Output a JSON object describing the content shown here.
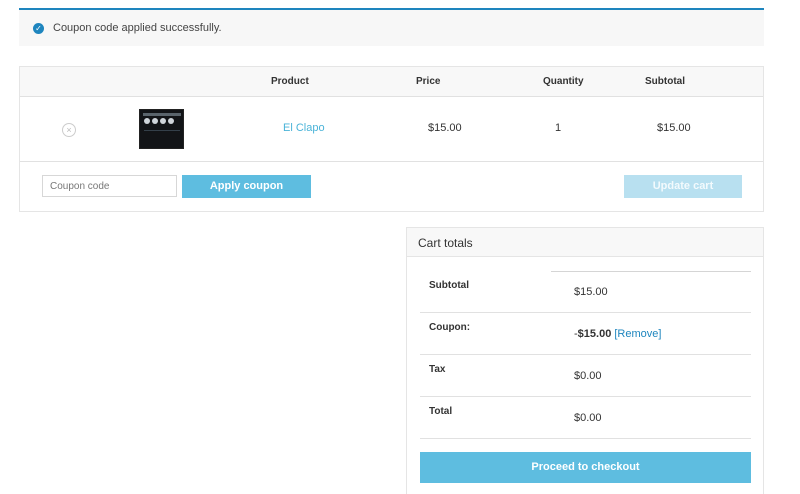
{
  "notice": {
    "message": "Coupon code applied successfully.",
    "icon": "check-circle-icon",
    "accent": "#1e85be"
  },
  "cart": {
    "headers": {
      "product": "Product",
      "price": "Price",
      "quantity": "Quantity",
      "subtotal": "Subtotal"
    },
    "items": [
      {
        "name": "El Clapo",
        "price": "$15.00",
        "quantity": "1",
        "subtotal": "$15.00",
        "remove_icon": "remove-circle-icon"
      }
    ],
    "coupon_placeholder": "Coupon code",
    "apply_label": "Apply coupon",
    "update_label": "Update cart"
  },
  "totals": {
    "title": "Cart totals",
    "rows": [
      {
        "label": "Subtotal",
        "value": "$15.00"
      },
      {
        "label": "Coupon:",
        "value_prefix": "-",
        "value_amount": "$15.00",
        "remove_label": "[Remove]"
      },
      {
        "label": "Tax",
        "value": "$0.00"
      },
      {
        "label": "Total",
        "value": "$0.00"
      }
    ],
    "checkout_label": "Proceed to checkout"
  },
  "colors": {
    "button": "#5ebde0",
    "button_disabled": "#b8e0f0",
    "link": "#4ab3d8"
  }
}
